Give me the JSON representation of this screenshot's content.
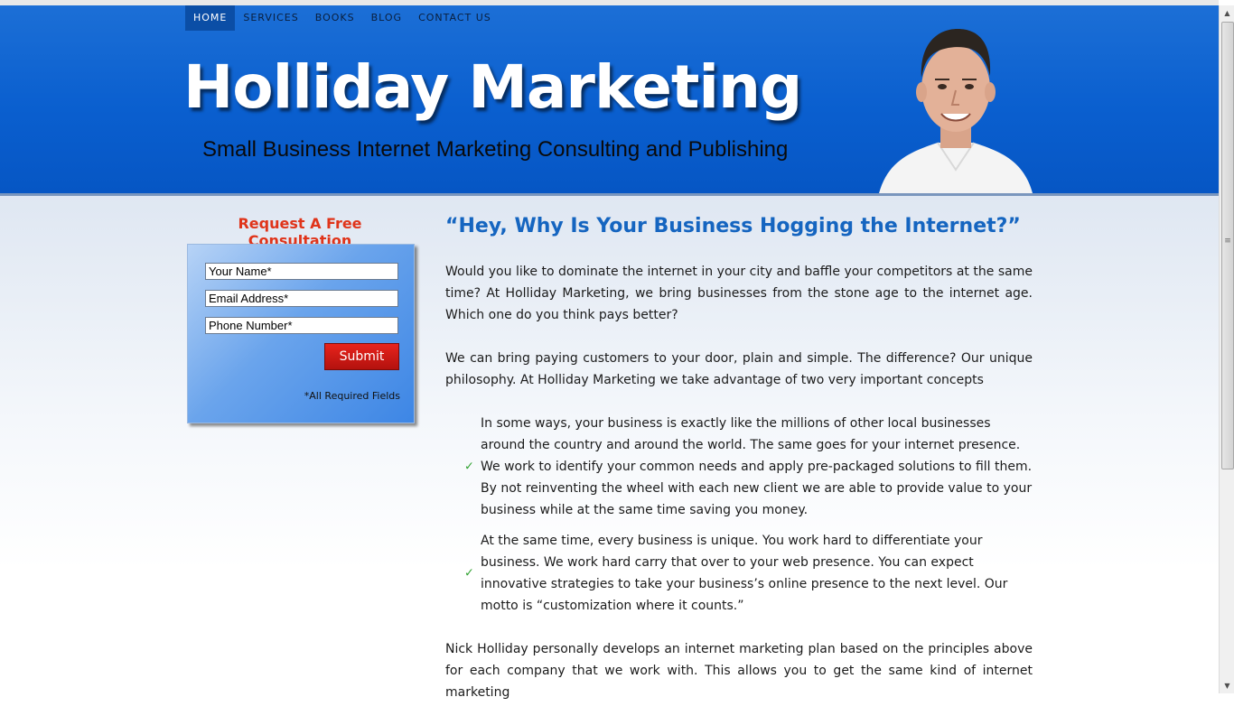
{
  "nav": {
    "items": [
      {
        "label": "HOME",
        "active": true
      },
      {
        "label": "SERVICES",
        "active": false
      },
      {
        "label": "BOOKS",
        "active": false
      },
      {
        "label": "BLOG",
        "active": false
      },
      {
        "label": "CONTACT US",
        "active": false
      }
    ]
  },
  "header": {
    "title": "Holliday Marketing",
    "tagline": "Small Business Internet Marketing Consulting and Publishing"
  },
  "sidebar": {
    "title": "Request A Free Consultation",
    "fields": {
      "name_placeholder": "Your Name*",
      "email_placeholder": "Email Address*",
      "phone_placeholder": "Phone Number*"
    },
    "submit_label": "Submit",
    "required_note": "*All Required Fields"
  },
  "main": {
    "headline": "“Hey, Why Is Your Business Hogging the Internet?”",
    "para1": "Would you like to dominate the internet in your city and baffle your competitors at the same time?  At Holliday Marketing, we bring businesses from the stone age to the internet age.  Which one do you think pays better?",
    "para2": "We can bring paying customers to your door, plain and simple.  The difference? Our unique philosophy.  At Holliday Marketing we take advantage of two very important concepts",
    "bullets": [
      "In some ways, your business is exactly like the millions of other local businesses around the country and around the world.  The same goes for your internet presence.  We work to identify your common needs and apply pre-packaged solutions to fill them.  By not reinventing the wheel with each new client we are able to provide value to your business while at the same time saving you money.",
      "At the same time, every business is unique.  You work hard to differentiate your business.  We work hard carry that over to your web presence.  You can expect innovative strategies to take your business’s online presence to the next level.  Our motto is “customization where it counts.”"
    ],
    "para3": "Nick Holliday personally develops an internet marketing plan based on the principles above for each company that we work with.  This allows you to get the same kind of internet marketing"
  },
  "icons": {
    "bullet": "checkmark-icon",
    "scroll_up": "arrow-up-icon",
    "scroll_down": "arrow-down-icon"
  },
  "colors": {
    "header_blue": "#0a5fcf",
    "accent_red": "#e0341a",
    "headline_blue": "#1565c0",
    "check_green": "#2fa12f"
  }
}
